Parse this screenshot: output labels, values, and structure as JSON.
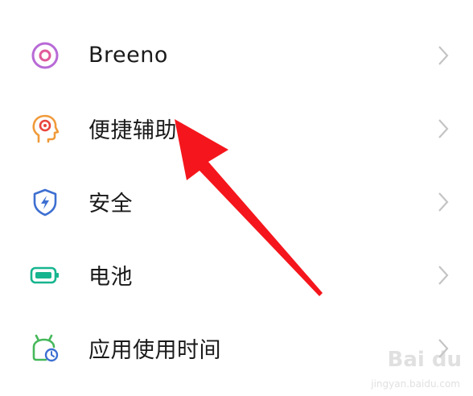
{
  "settings": {
    "items": [
      {
        "label": "Breeno",
        "icon": "breeno-icon",
        "icon_color": "#b86ad6"
      },
      {
        "label": "便捷辅助",
        "icon": "assist-head-icon",
        "icon_color": "#f09a3a"
      },
      {
        "label": "安全",
        "icon": "security-shield-icon",
        "icon_color": "#3d6fd1"
      },
      {
        "label": "电池",
        "icon": "battery-icon",
        "icon_color": "#17b58f"
      },
      {
        "label": "应用使用时间",
        "icon": "app-usage-time-icon",
        "icon_color": "#45b85a"
      }
    ]
  },
  "annotation": {
    "arrow_color": "#f4161c"
  },
  "watermark": {
    "brand": "Bai du",
    "sub": "jingyan.baidu.com"
  }
}
